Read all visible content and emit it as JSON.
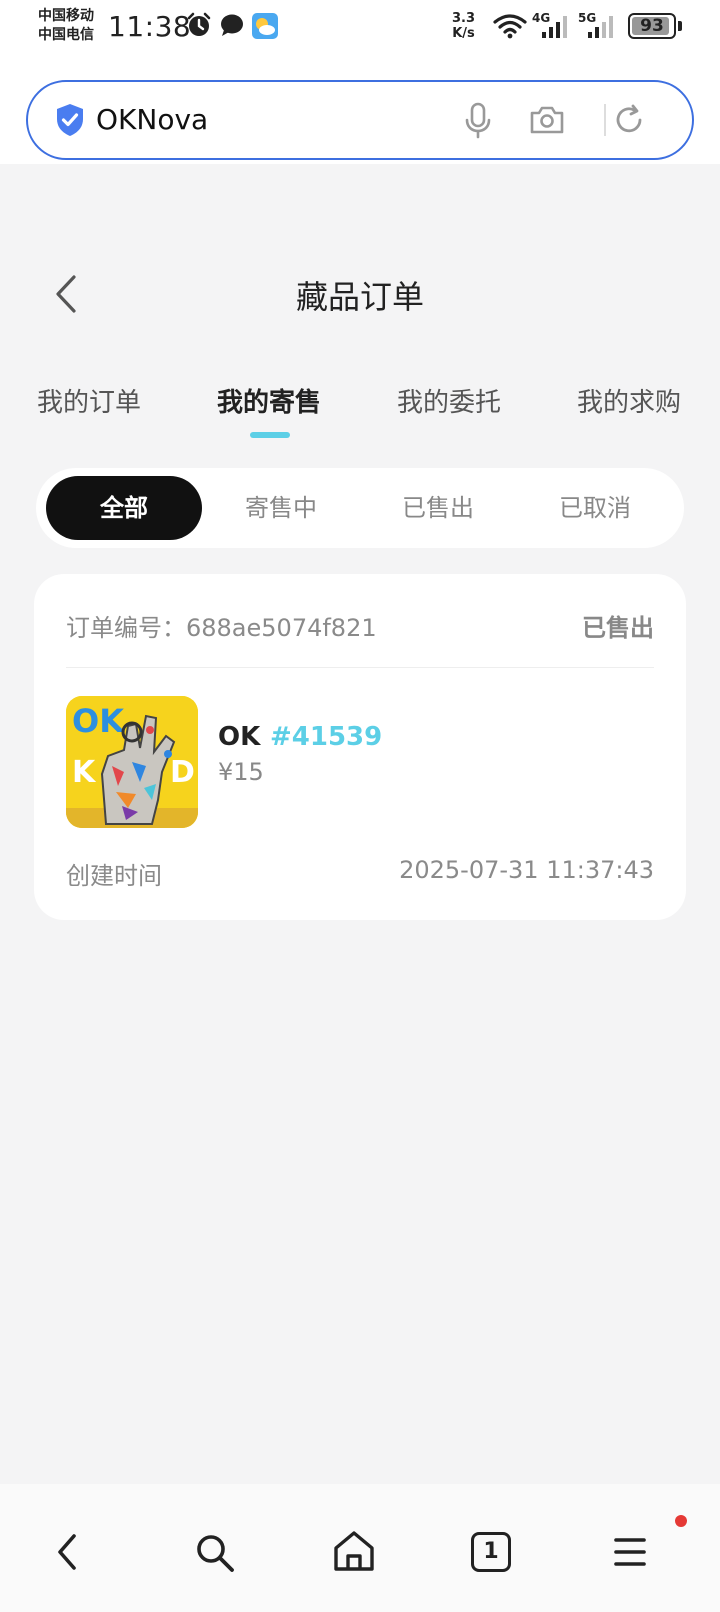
{
  "status_bar": {
    "carrier_1": "中国移动",
    "carrier_2": "中国电信",
    "time": "11:38",
    "net_speed_value": "3.3",
    "net_speed_unit": "K/s",
    "net_4g": "4G",
    "net_5g": "5G",
    "battery": "93",
    "battery_level": 0.93,
    "icons": [
      "alarm-icon",
      "chat-bubble-icon",
      "weather-icon",
      "wifi-icon",
      "signal-icon",
      "signal-icon",
      "battery-icon"
    ]
  },
  "search": {
    "text": "OKNova",
    "icons": [
      "shield-icon",
      "microphone-icon",
      "camera-icon",
      "refresh-icon"
    ],
    "accent": "#3d6fe0"
  },
  "header": {
    "title": "藏品订单",
    "back_icon": "chevron-left-icon"
  },
  "tabs": [
    {
      "label": "我的订单",
      "active": false
    },
    {
      "label": "我的寄售",
      "active": true
    },
    {
      "label": "我的委托",
      "active": false
    },
    {
      "label": "我的求购",
      "active": false
    }
  ],
  "filters": [
    {
      "label": "全部",
      "active": true
    },
    {
      "label": "寄售中",
      "active": false
    },
    {
      "label": "已售出",
      "active": false
    },
    {
      "label": "已取消",
      "active": false
    }
  ],
  "order": {
    "number_label": "订单编号：",
    "number": "688ae5074f821",
    "status": "已售出",
    "item_name": "OK",
    "item_no": "#41539",
    "price": "¥15",
    "created_label": "创建时间",
    "created_time": "2025-07-31 11:37:43",
    "thumb_text": "OK"
  },
  "bottom_nav": {
    "icons": [
      "back-icon",
      "search-icon",
      "home-icon",
      "tabs-icon",
      "menu-icon"
    ],
    "tab_count": "1"
  },
  "colors": {
    "accent_cyan": "#5ccfe6",
    "active_pill": "#111111",
    "notification": "#e53935"
  }
}
